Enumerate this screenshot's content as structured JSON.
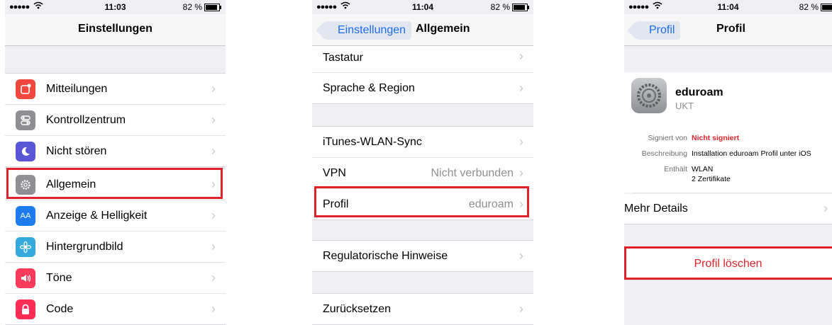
{
  "colors": {
    "highlight": "#e0222a",
    "link": "#1a6cf0",
    "destructive": "#e0222a"
  },
  "screens": [
    {
      "status": {
        "signal": "●●●●●",
        "time": "11:03",
        "battery": "82 %"
      },
      "nav": {
        "title": "Einstellungen"
      },
      "items": [
        {
          "label": "Mitteilungen",
          "icon": "notifications-icon"
        },
        {
          "label": "Kontrollzentrum",
          "icon": "control-center-icon"
        },
        {
          "label": "Nicht stören",
          "icon": "moon-icon"
        },
        {
          "label": "Allgemein",
          "icon": "gear-icon"
        },
        {
          "label": "Anzeige & Helligkeit",
          "icon": "display-brightness-icon"
        },
        {
          "label": "Hintergrundbild",
          "icon": "wallpaper-icon"
        },
        {
          "label": "Töne",
          "icon": "sounds-icon"
        },
        {
          "label": "Code",
          "icon": "passcode-icon"
        }
      ]
    },
    {
      "status": {
        "signal": "●●●●●",
        "time": "11:04",
        "battery": "82 %"
      },
      "nav": {
        "back": "Einstellungen",
        "title": "Allgemein"
      },
      "items": [
        {
          "label": "Tastatur",
          "detail": ""
        },
        {
          "label": "Sprache & Region",
          "detail": ""
        },
        {
          "label": "iTunes-WLAN-Sync",
          "detail": ""
        },
        {
          "label": "VPN",
          "detail": "Nicht verbunden"
        },
        {
          "label": "Profil",
          "detail": "eduroam"
        },
        {
          "label": "Regulatorische Hinweise",
          "detail": ""
        },
        {
          "label": "Zurücksetzen",
          "detail": ""
        }
      ]
    },
    {
      "status": {
        "signal": "●●●●●",
        "time": "11:04",
        "battery": "82 %"
      },
      "nav": {
        "back": "Profil",
        "title": "Profil"
      },
      "profile": {
        "name": "eduroam",
        "org": "UKT",
        "signed_key": "Signiert von",
        "signed_val": "Nicht signiert",
        "desc_key": "Beschreibung",
        "desc_val": "Installation eduroam Profil unter iOS",
        "contains_key": "Enthält",
        "contains_val1": "WLAN",
        "contains_val2": "2 Zertifikate",
        "more": "Mehr Details",
        "delete": "Profil löschen"
      }
    }
  ]
}
